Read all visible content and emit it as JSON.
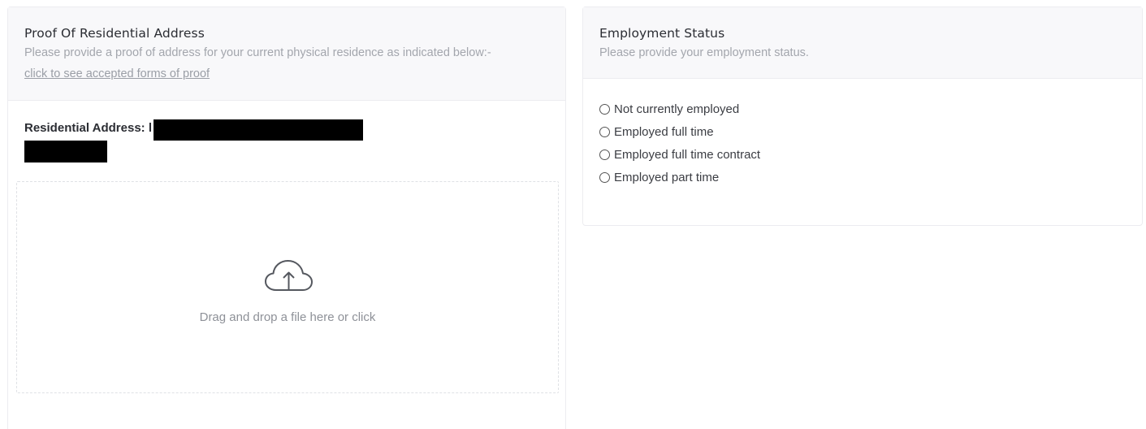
{
  "proof_card": {
    "title": "Proof Of Residential Address",
    "subtitle": "Please provide a proof of address for your current physical residence as indicated below:-",
    "link": "click to see accepted forms of proof",
    "address_label": "Residential Address: l",
    "dropzone_text": "Drag and drop a file here or click",
    "upload_icon": "cloud-upload-icon"
  },
  "employment_card": {
    "title": "Employment Status",
    "subtitle": "Please provide your employment status.",
    "options": [
      {
        "label": "Not currently employed",
        "selected": false
      },
      {
        "label": "Employed full time",
        "selected": false
      },
      {
        "label": "Employed full time contract",
        "selected": false
      },
      {
        "label": "Employed part time",
        "selected": false
      }
    ]
  }
}
